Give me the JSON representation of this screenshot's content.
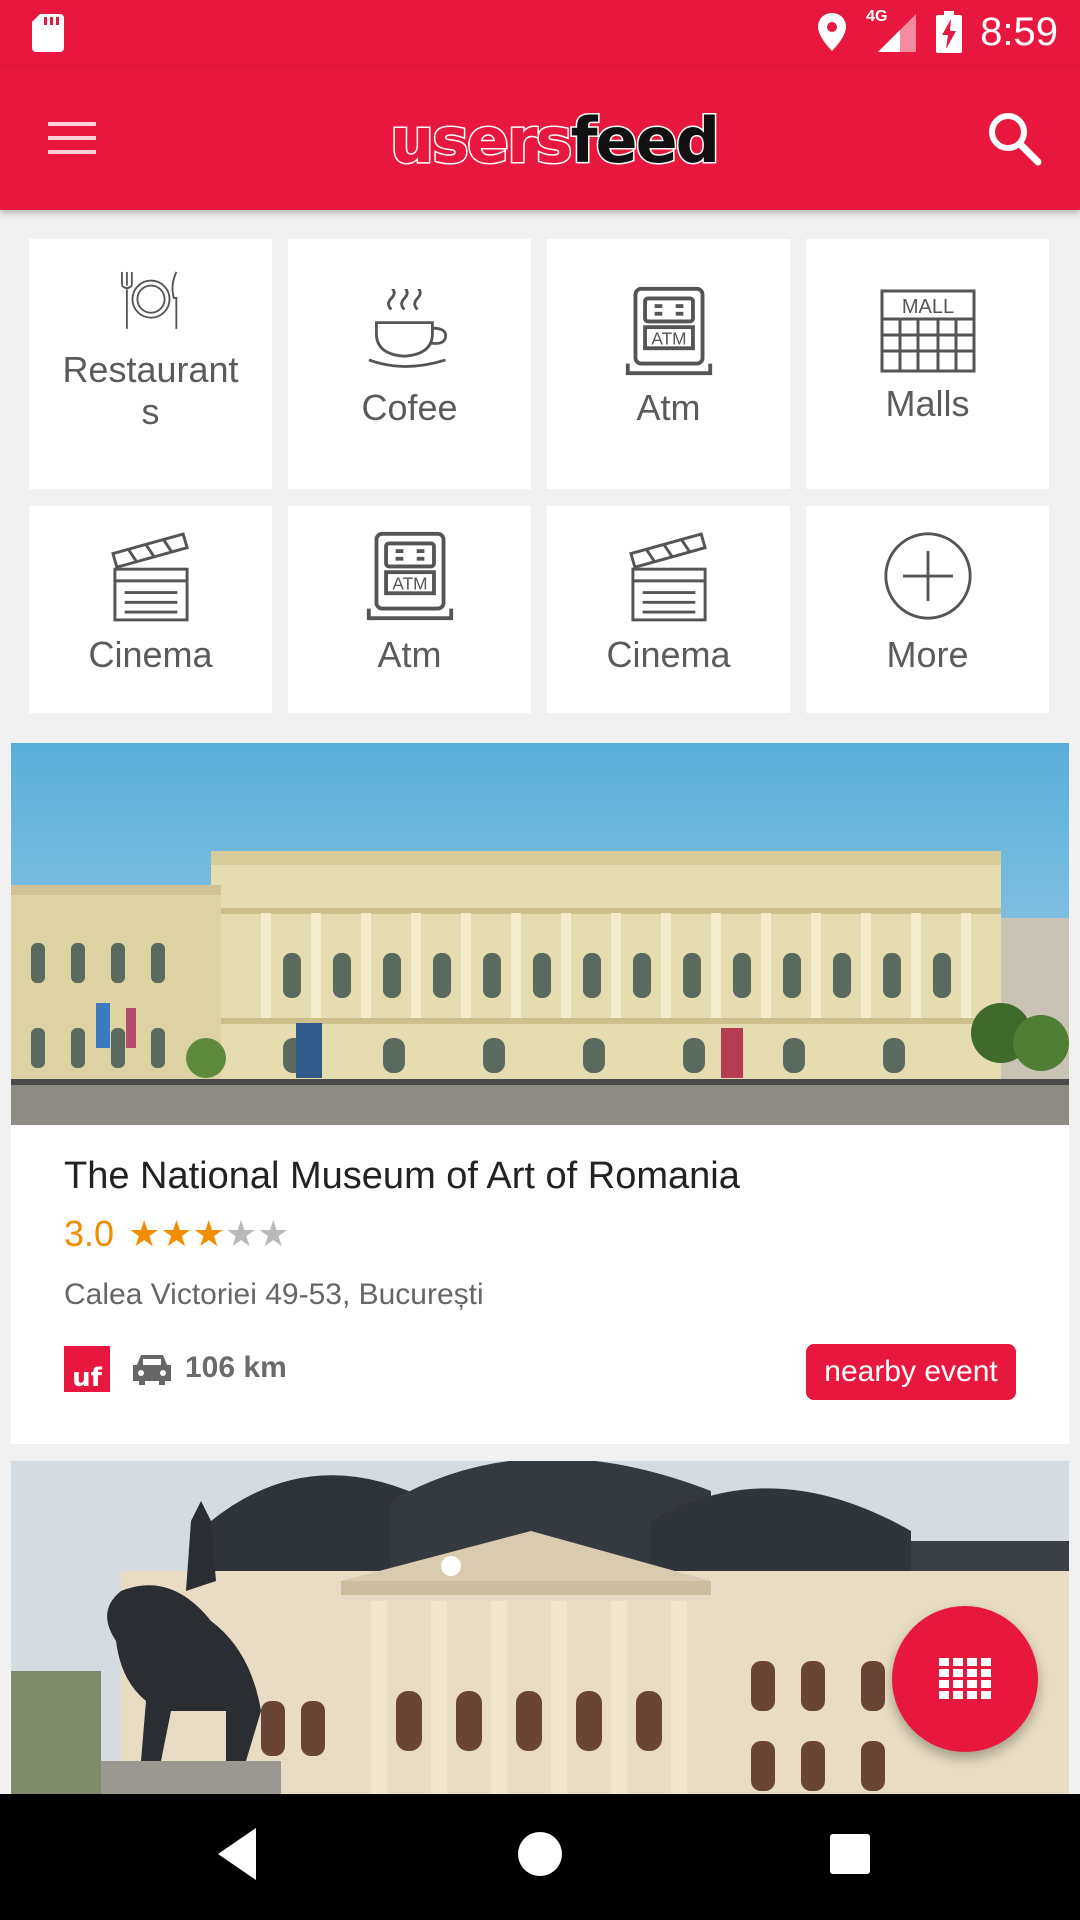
{
  "status_bar": {
    "network": "4G",
    "time": "8:59"
  },
  "app_bar": {
    "logo_part1": "users",
    "logo_part2": "feed"
  },
  "categories": [
    {
      "label": "Restaurant\ns",
      "icon": "restaurant-icon"
    },
    {
      "label": "Cofee",
      "icon": "coffee-icon"
    },
    {
      "label": "Atm",
      "icon": "atm-icon"
    },
    {
      "label": "Malls",
      "icon": "mall-icon"
    },
    {
      "label": "Cinema",
      "icon": "cinema-icon"
    },
    {
      "label": "Atm",
      "icon": "atm-icon"
    },
    {
      "label": "Cinema",
      "icon": "cinema-icon"
    },
    {
      "label": "More",
      "icon": "plus-circle-icon"
    }
  ],
  "icon_text": {
    "atm": "ATM",
    "mall": "MALL",
    "uf": "uf"
  },
  "place": {
    "title": "The National Museum of Art of Romania",
    "rating": "3.0",
    "rating_value": 3,
    "rating_max": 5,
    "address": "Calea Victoriei 49-53, București",
    "distance": "106 km",
    "badge": "nearby event"
  },
  "colors": {
    "brand": "#e8173d",
    "star": "#f28c00",
    "star_off": "#b9b9b9"
  }
}
